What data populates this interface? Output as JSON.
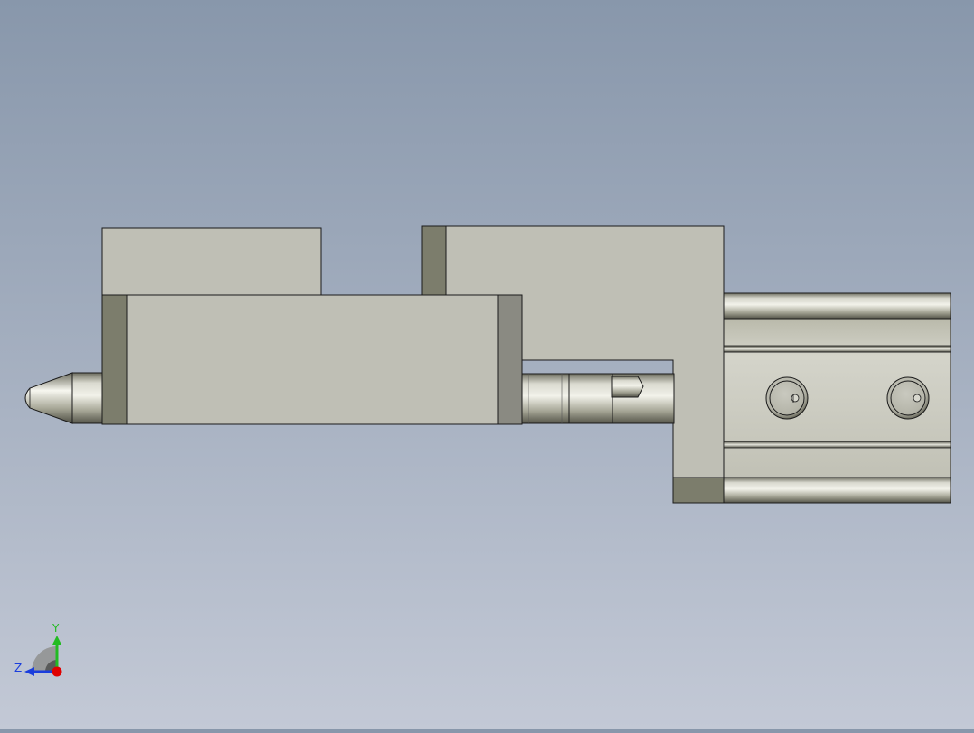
{
  "viewport": {
    "background_top": "#8897ab",
    "background_bottom": "#c3c9d6",
    "part_face_color": "#bfbfb5",
    "part_edge_color": "#1a1a1a",
    "chamfer_color": "#7c7d6c"
  },
  "triad": {
    "x_axis_color": "#e00000",
    "y_axis_color": "#22bb22",
    "z_axis_color": "#1a3ddd",
    "y_label": "Y",
    "z_label": "Z"
  }
}
